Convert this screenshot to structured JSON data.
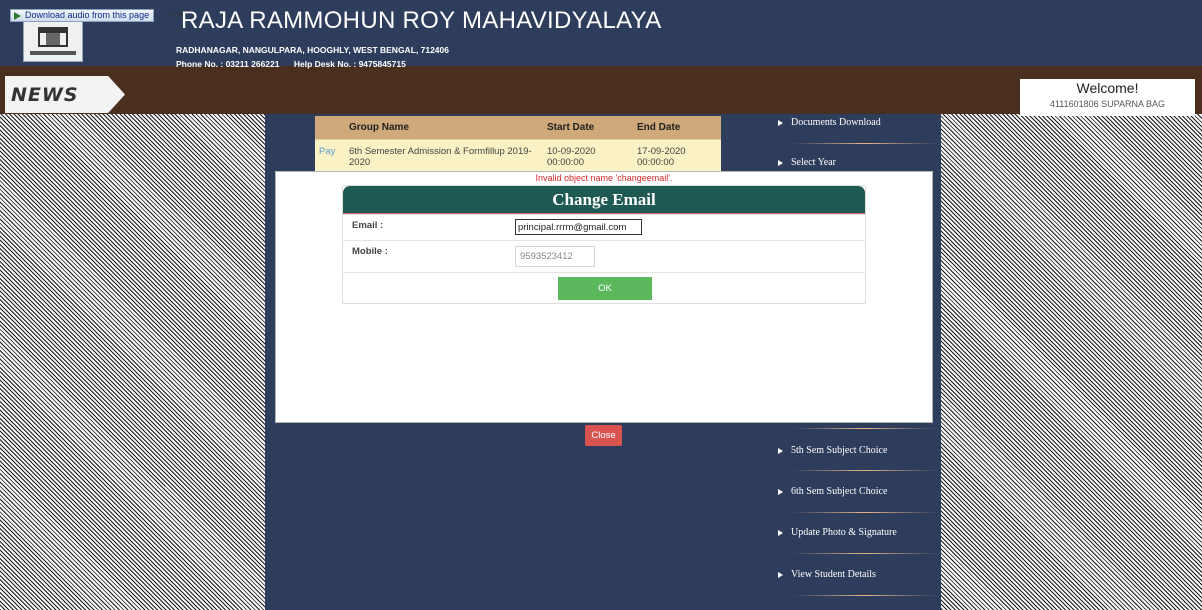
{
  "browser_bar": {
    "download_label": "Download audio from this page",
    "extra": "|? X"
  },
  "header": {
    "title": "RAJA RAMMOHUN ROY MAHAVIDYALAYA",
    "address": "RADHANAGAR, NANGULPARA, HOOGHLY, WEST BENGAL, 712406",
    "phone": "Phone No. : 03211 266221",
    "helpdesk": "Help Desk No. : 9475845715"
  },
  "news": {
    "label": "NEWS"
  },
  "welcome": {
    "title": "Welcome!",
    "user": "4111601806 SUPARNA BAG"
  },
  "table": {
    "headers": [
      "",
      "Group Name",
      "Start Date",
      "End Date"
    ],
    "rows": [
      {
        "action": "Pay",
        "group": "6th Semester Admission & Formfillup 2019-2020",
        "start": "10-09-2020 00:00:00",
        "end": "17-09-2020 00:00:00"
      }
    ]
  },
  "sidebar": {
    "items": [
      {
        "label": "Documents Download"
      },
      {
        "label": "Select Year"
      },
      {
        "label": "5th Sem Subject Choice"
      },
      {
        "label": "6th Sem Subject Choice"
      },
      {
        "label": "Update Photo & Signature"
      },
      {
        "label": "View Student Details"
      }
    ]
  },
  "modal": {
    "error": "Invalid object name 'changeemail'.",
    "title": "Change Email",
    "email_label": "Email :",
    "email_value": "principal.rrrm@gmail.com",
    "mobile_label": "Mobile :",
    "mobile_value": "9593523412",
    "ok_label": "OK",
    "close_label": "Close"
  },
  "colors": {
    "header_bg": "#2f3d5c",
    "news_bg": "#4a2f1e",
    "table_header": "#d0a97b",
    "table_row": "#faf1c4",
    "modal_head": "#1e5a52",
    "ok_button": "#5cb85c",
    "close_button": "#d9534f",
    "error_text": "#d82a2a"
  }
}
